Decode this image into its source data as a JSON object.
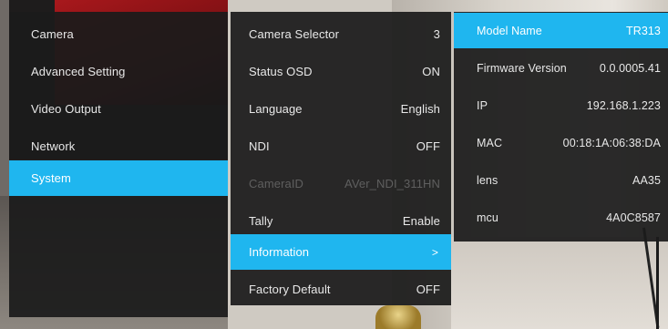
{
  "main_menu": {
    "items": [
      {
        "label": "Camera"
      },
      {
        "label": "Advanced Setting"
      },
      {
        "label": "Video Output"
      },
      {
        "label": "Network"
      },
      {
        "label": "System"
      }
    ],
    "selected": "System"
  },
  "system_menu": {
    "items": [
      {
        "label": "Camera Selector",
        "value": "3"
      },
      {
        "label": "Status OSD",
        "value": "ON"
      },
      {
        "label": "Language",
        "value": "English"
      },
      {
        "label": "NDI",
        "value": "OFF"
      },
      {
        "label": "CameraID",
        "value": "AVer_NDI_311HN"
      },
      {
        "label": "Tally",
        "value": "Enable"
      },
      {
        "label": "Information",
        "value": ">"
      },
      {
        "label": "Factory Default",
        "value": "OFF"
      }
    ],
    "selected": "Information",
    "disabled": [
      "CameraID"
    ]
  },
  "info_menu": {
    "items": [
      {
        "label": "Model Name",
        "value": "TR313"
      },
      {
        "label": "Firmware Version",
        "value": "0.0.0005.41"
      },
      {
        "label": "IP",
        "value": "192.168.1.223"
      },
      {
        "label": "MAC",
        "value": "00:18:1A:06:38:DA"
      },
      {
        "label": "lens",
        "value": "AA35"
      },
      {
        "label": "mcu",
        "value": "4A0C8587"
      }
    ],
    "selected": "Model Name"
  },
  "colors": {
    "panel_bg": "#1b1b1b",
    "highlight": "#1fb6ef",
    "text": "#e8e8e8",
    "disabled_text": "#5f5f5f"
  }
}
